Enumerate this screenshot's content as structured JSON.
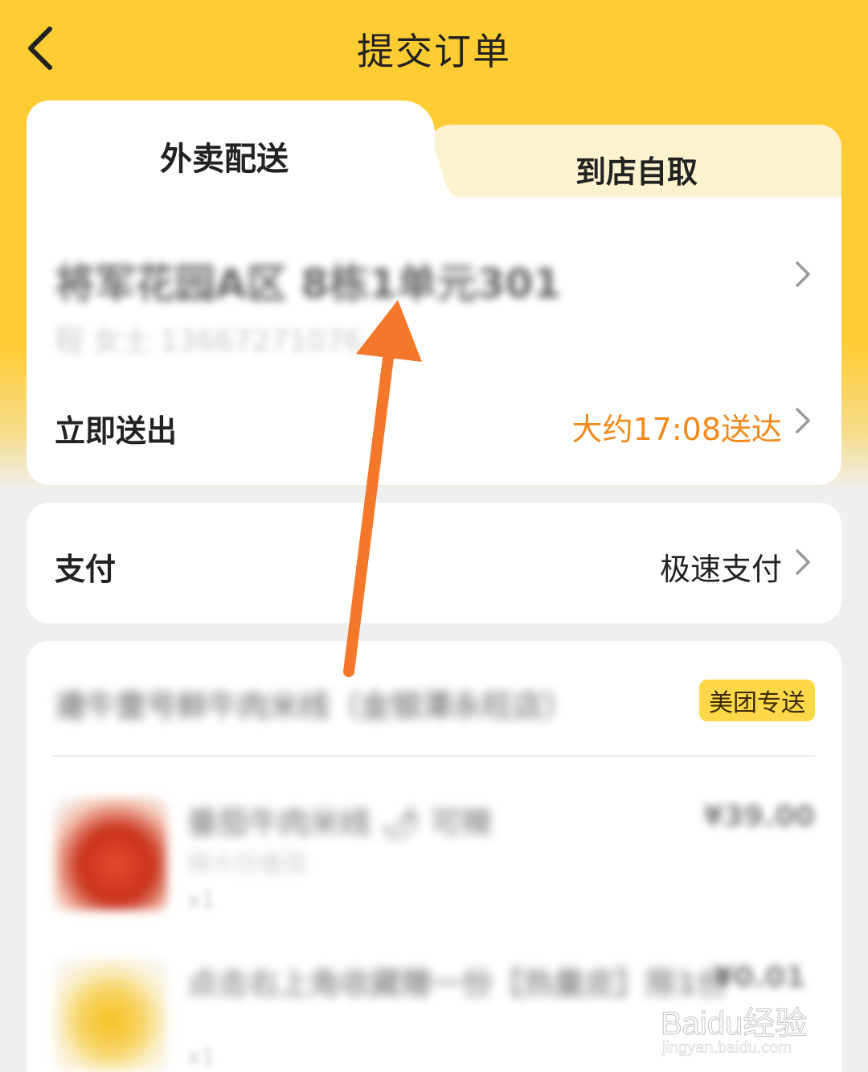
{
  "header": {
    "title": "提交订单",
    "back_icon": "chevron-left-icon"
  },
  "delivery_tabs": {
    "active_label": "外卖配送",
    "inactive_label": "到店自取"
  },
  "address": {
    "line": "将军花园A区 8栋1单元301",
    "contact": "程 女士    13667271076"
  },
  "delivery_time": {
    "label": "立即送出",
    "eta": "大约17:08送达"
  },
  "payment": {
    "label": "支付",
    "value": "极速支付"
  },
  "order": {
    "shop_name": "遵牛壹号鲜牛肉米线（金银潭永旺店）",
    "badge": "美团专送",
    "items": [
      {
        "name": "番茄牛肉米线 🌶 可辣",
        "sub": "辣大份番茄",
        "qty": "x1",
        "price": "¥39.00"
      },
      {
        "name": "点击右上角收藏赠一份【热量皮】限1份",
        "sub": "",
        "qty": "x1",
        "price": "¥0.01"
      }
    ]
  },
  "colors": {
    "brand_yellow": "#ffcc33",
    "eta_orange": "#f08a1a",
    "annotation_arrow": "#f5782a",
    "badge_yellow": "#ffd84a"
  },
  "watermark": {
    "logo": "Baidu经验",
    "url": "jingyan.baidu.com"
  }
}
